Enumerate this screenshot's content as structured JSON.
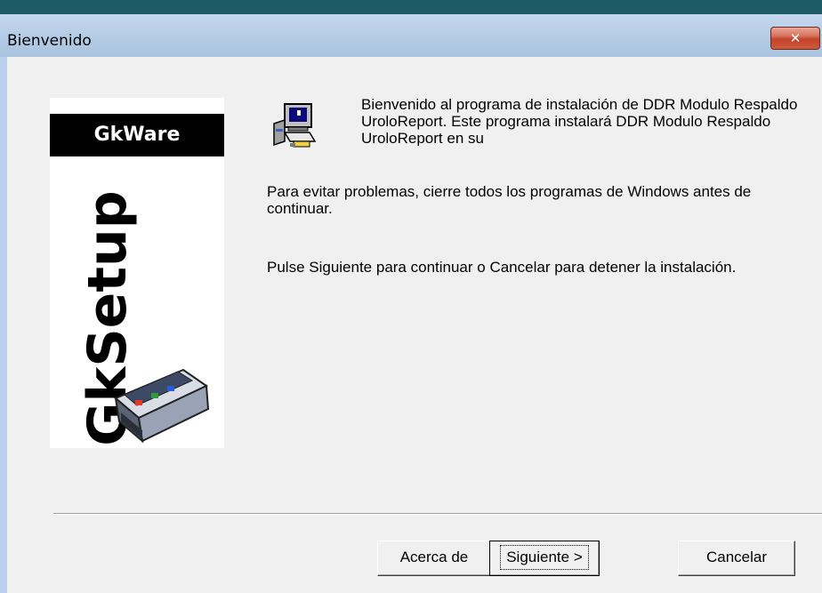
{
  "window": {
    "title": "Bienvenido",
    "close_symbol": "✕"
  },
  "banner": {
    "brand": "GkWare",
    "product": "GkSetup",
    "art_icon": "installer-box-icon"
  },
  "content": {
    "icon": "computer-setup-icon",
    "welcome_text": "Bienvenido al programa de instalación de DDR Modulo Respaldo UroloReport. Este programa instalará DDR Modulo Respaldo UroloReport en su",
    "warning_text": "Para evitar problemas, cierre todos los programas de Windows antes de continuar.",
    "instruction_text": "Pulse Siguiente para continuar o Cancelar para detener la instalación."
  },
  "buttons": {
    "about": "Acerca de",
    "next": "Siguiente >",
    "cancel": "Cancelar"
  },
  "colors": {
    "titlebar": "#b9d1ea",
    "client": "#f0f0f0",
    "close": "#c2432a"
  }
}
